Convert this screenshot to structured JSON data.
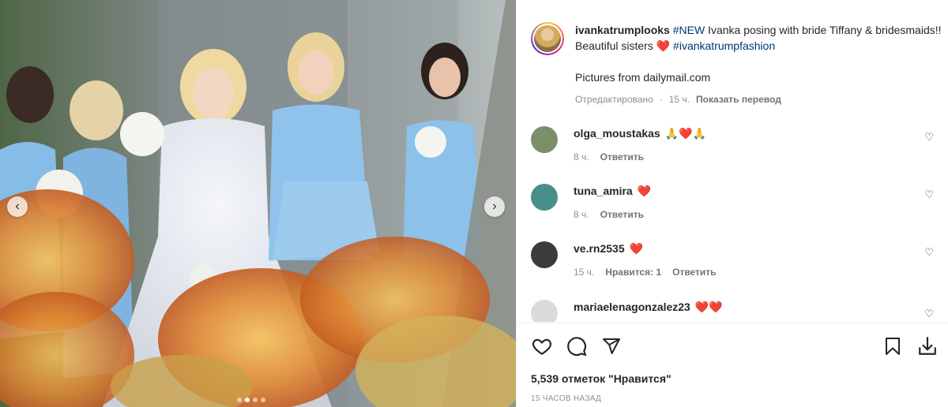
{
  "post": {
    "author": "ivankatrumplooks",
    "caption_tag_new": "#NEW",
    "caption_text": " Ivanka posing with bride Tiffany & bridesmaids!! Beautiful sisters ",
    "caption_heart": "❤️",
    "caption_tag_fashion": "#ivankatrumpfashion",
    "caption_extra": "Pictures from dailymail.com",
    "edited_label": "Отредактировано",
    "edited_time": "15 ч.",
    "translate_label": "Показать перевод"
  },
  "comments": [
    {
      "user": "olga_moustakas",
      "text": "🙏❤️🙏",
      "time": "8 ч.",
      "likes": "",
      "reply": "Ответить",
      "avatar_color": "#7d8f6a"
    },
    {
      "user": "tuna_amira",
      "text": "❤️",
      "time": "8 ч.",
      "likes": "",
      "reply": "Ответить",
      "avatar_color": "#4a8e8a"
    },
    {
      "user": "ve.rn2535",
      "text": "❤️",
      "time": "15 ч.",
      "likes": "Нравится: 1",
      "reply": "Ответить",
      "avatar_color": "#3b3b3b"
    },
    {
      "user": "mariaelenagonzalez23",
      "text": "❤️❤️",
      "time": "",
      "likes": "",
      "reply": "",
      "avatar_color": "#dbdbdb"
    }
  ],
  "stats": {
    "likes": "5,539 отметок \"Нравится\"",
    "posted": "15 ЧАСОВ НАЗАД"
  },
  "icons": {
    "like": "heart-outline-icon",
    "comment": "comment-bubble-icon",
    "share": "paper-plane-icon",
    "save": "bookmark-icon",
    "download": "download-icon",
    "prev": "chevron-left-icon",
    "next": "chevron-right-icon"
  },
  "carousel": {
    "slides": 4,
    "active": 2
  },
  "colors": {
    "link": "#00376b",
    "heart": "#ed4956",
    "muted": "#8e8e8e",
    "dress_blue": "#8fc3ec"
  }
}
